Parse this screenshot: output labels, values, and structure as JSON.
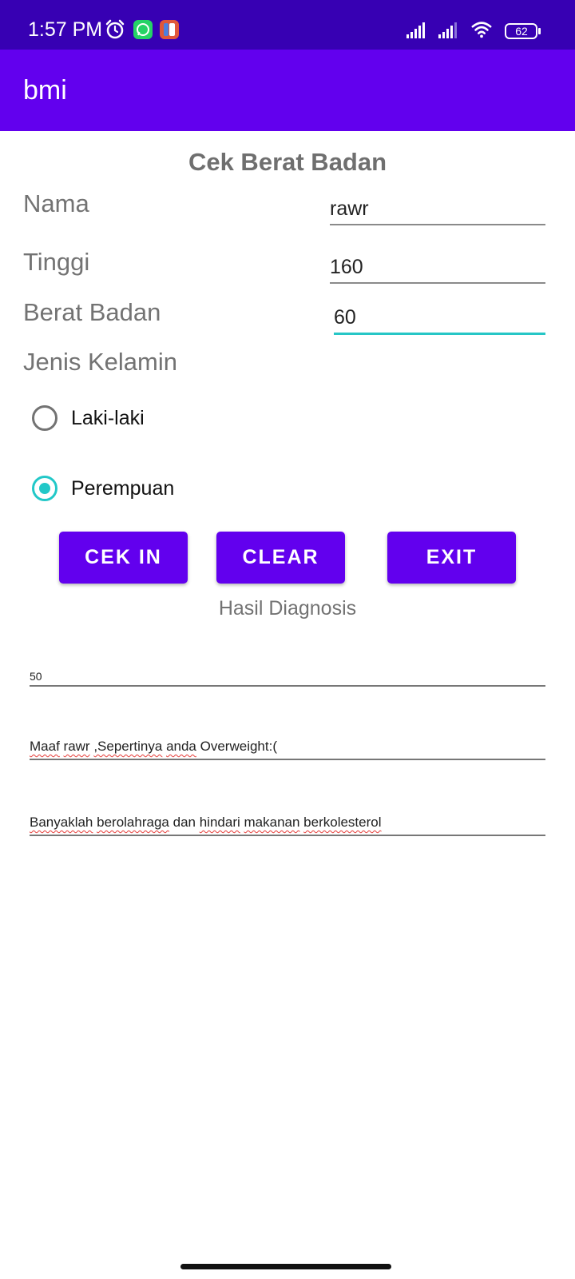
{
  "status_bar": {
    "time": "1:57 PM",
    "battery": "62",
    "icons": [
      "alarm-icon",
      "whatsapp-icon",
      "notif-app-icon",
      "signal-icon",
      "signal-icon",
      "wifi-icon",
      "battery-icon"
    ]
  },
  "app_bar": {
    "title": "bmi"
  },
  "form": {
    "heading": "Cek Berat Badan",
    "nama_label": "Nama",
    "nama_value": "rawr",
    "tinggi_label": "Tinggi",
    "tinggi_value": "160",
    "berat_label": "Berat Badan",
    "berat_value": "60",
    "jenis_label": "Jenis Kelamin",
    "gender_options": [
      {
        "label": "Laki-laki",
        "selected": false
      },
      {
        "label": "Perempuan",
        "selected": true
      }
    ]
  },
  "buttons": {
    "cek_in": "CEK IN",
    "clear": "CLEAR",
    "exit": "EXIT"
  },
  "result": {
    "label": "Hasil Diagnosis",
    "value": "50",
    "message_words": [
      "Maaf",
      "rawr",
      ",Sepertinya",
      "anda",
      "Overweight:("
    ],
    "advice_words": [
      "Banyaklah",
      "berolahraga",
      "dan",
      "hindari",
      "makanan",
      "berkolesterol"
    ]
  },
  "colors": {
    "status_bar": "#3700b3",
    "app_bar": "#6200ee",
    "button": "#6200ee",
    "accent": "#22c8c8",
    "spellcheck": "#e53935"
  }
}
